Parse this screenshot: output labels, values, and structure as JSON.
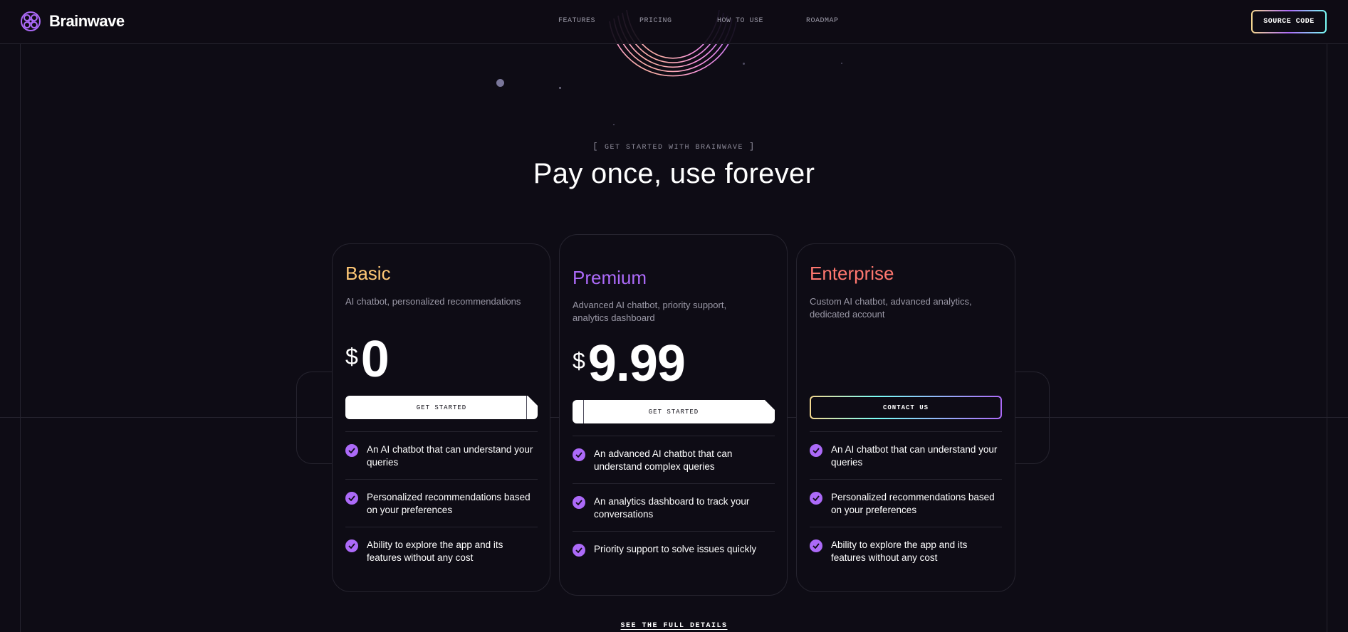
{
  "brand": {
    "name": "Brainwave",
    "accent": "#ac6af8"
  },
  "nav": {
    "items": [
      {
        "label": "Features"
      },
      {
        "label": "Pricing"
      },
      {
        "label": "How to use"
      },
      {
        "label": "Roadmap"
      }
    ],
    "source_button": "Source code"
  },
  "section": {
    "eyebrow": "Get started with Brainwave",
    "heading": "Pay once, use forever"
  },
  "plans": [
    {
      "title": "Basic",
      "color": "#ffc876",
      "description": "AI chatbot, personalized recommendations",
      "currency": "$",
      "price": "0",
      "button": "Get started",
      "features": [
        "An AI chatbot that can understand your queries",
        "Personalized recommendations based on your preferences",
        "Ability to explore the app and its features without any cost"
      ]
    },
    {
      "title": "Premium",
      "color": "#ac6af8",
      "description": "Advanced AI chatbot, priority support, analytics dashboard",
      "currency": "$",
      "price": "9.99",
      "button": "Get started",
      "features": [
        "An advanced AI chatbot that can understand complex queries",
        "An analytics dashboard to track your conversations",
        "Priority support to solve issues quickly"
      ]
    },
    {
      "title": "Enterprise",
      "color": "#ff776f",
      "description": "Custom AI chatbot, advanced analytics, dedicated account",
      "button": "Contact us",
      "features": [
        "An AI chatbot that can understand your queries",
        "Personalized recommendations based on your preferences",
        "Ability to explore the app and its features without any cost"
      ]
    }
  ],
  "footer_link": "See the full details"
}
